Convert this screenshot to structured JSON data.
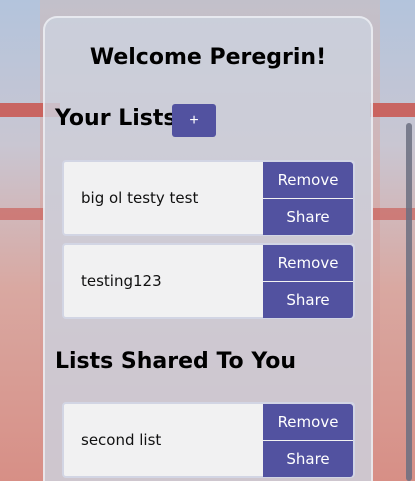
{
  "header": {
    "welcome": "Welcome Peregrin!"
  },
  "your_lists": {
    "title": "Your Lists",
    "add_label": "+",
    "items": [
      {
        "name": "big ol testy test",
        "remove_label": "Remove",
        "share_label": "Share"
      },
      {
        "name": "testing123",
        "remove_label": "Remove",
        "share_label": "Share"
      }
    ]
  },
  "shared_lists": {
    "title": "Lists Shared To You",
    "items": [
      {
        "name": "second list",
        "remove_label": "Remove",
        "share_label": "Share"
      }
    ]
  },
  "colors": {
    "accent": "#5252a0",
    "panel": "#ccd2de",
    "card": "#f1f1f2"
  }
}
